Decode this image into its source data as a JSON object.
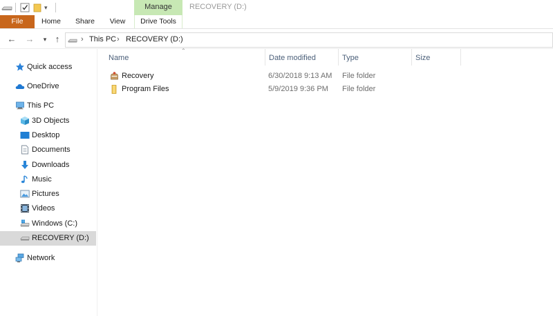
{
  "window": {
    "title": "RECOVERY (D:)",
    "contextual_tab": "Manage"
  },
  "ribbon": {
    "tabs": [
      "File",
      "Home",
      "Share",
      "View",
      "Drive Tools"
    ]
  },
  "address_bar": {
    "breadcrumbs": [
      "This PC",
      "RECOVERY (D:)"
    ]
  },
  "nav_pane": {
    "items": [
      {
        "label": "Quick access",
        "icon": "star-icon",
        "level": 0,
        "selected": false
      },
      {
        "label": "OneDrive",
        "icon": "cloud-icon",
        "level": 0,
        "selected": false
      },
      {
        "label": "This PC",
        "icon": "computer-icon",
        "level": 0,
        "selected": false
      },
      {
        "label": "3D Objects",
        "icon": "cube-icon",
        "level": 1,
        "selected": false
      },
      {
        "label": "Desktop",
        "icon": "desktop-icon",
        "level": 1,
        "selected": false
      },
      {
        "label": "Documents",
        "icon": "document-icon",
        "level": 1,
        "selected": false
      },
      {
        "label": "Downloads",
        "icon": "download-arrow-icon",
        "level": 1,
        "selected": false
      },
      {
        "label": "Music",
        "icon": "music-note-icon",
        "level": 1,
        "selected": false
      },
      {
        "label": "Pictures",
        "icon": "picture-icon",
        "level": 1,
        "selected": false
      },
      {
        "label": "Videos",
        "icon": "film-icon",
        "level": 1,
        "selected": false
      },
      {
        "label": "Windows (C:)",
        "icon": "windows-drive-icon",
        "level": 1,
        "selected": false
      },
      {
        "label": "RECOVERY (D:)",
        "icon": "drive-icon",
        "level": 1,
        "selected": true
      },
      {
        "label": "Network",
        "icon": "network-icon",
        "level": 0,
        "selected": false
      }
    ]
  },
  "file_list": {
    "columns": [
      "Name",
      "Date modified",
      "Type",
      "Size"
    ],
    "rows": [
      {
        "name": "Recovery",
        "date": "6/30/2018 9:13 AM",
        "type": "File folder",
        "icon": "recovery-folder-icon"
      },
      {
        "name": "Program Files",
        "date": "5/9/2019 9:36 PM",
        "type": "File folder",
        "icon": "folder-icon"
      }
    ]
  },
  "colors": {
    "file_tab": "#c8661b",
    "manage_tab": "#c7e8b4",
    "selected_nav": "#d9d9d9",
    "header_text": "#4c607a"
  }
}
